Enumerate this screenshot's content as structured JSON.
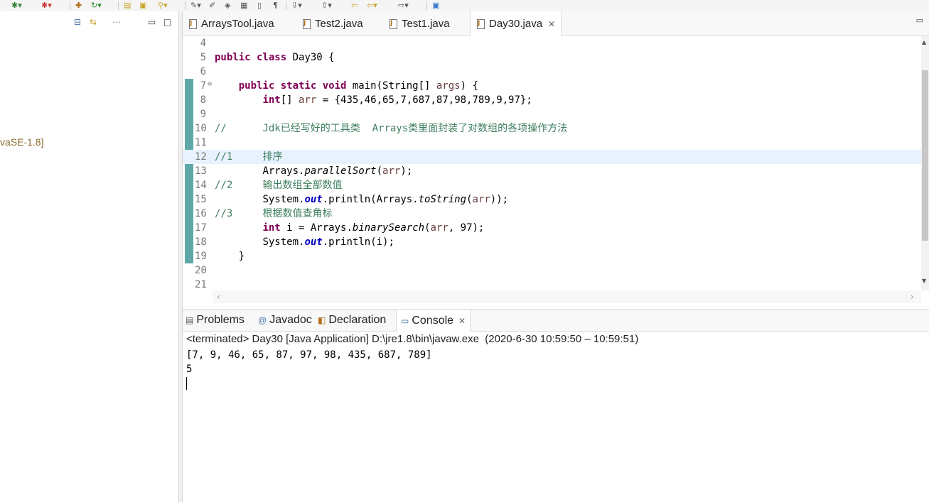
{
  "toolbar": {
    "icons": [
      "run-debug-icon",
      "run-icon",
      "new-icon",
      "open-icon",
      "search-icon",
      "nav-back-icon",
      "nav-forward-icon"
    ]
  },
  "left_pane": {
    "tree_item": "vaSE-1.8]"
  },
  "editor": {
    "tabs": [
      {
        "label": "ArraysTool.java"
      },
      {
        "label": "Test2.java"
      },
      {
        "label": "Test1.java"
      },
      {
        "label": "Day30.java",
        "active": true
      }
    ],
    "lines": [
      {
        "n": "4"
      },
      {
        "n": "5"
      },
      {
        "n": "6"
      },
      {
        "n": "7"
      },
      {
        "n": "8"
      },
      {
        "n": "9"
      },
      {
        "n": "10"
      },
      {
        "n": "11"
      },
      {
        "n": "12"
      },
      {
        "n": "13"
      },
      {
        "n": "14"
      },
      {
        "n": "15"
      },
      {
        "n": "16"
      },
      {
        "n": "17"
      },
      {
        "n": "18"
      },
      {
        "n": "19"
      },
      {
        "n": "20"
      },
      {
        "n": "21"
      }
    ],
    "code": {
      "l5_kw": "public class",
      "l5_rest": " Day30 {",
      "l7_kw": "public static void",
      "l7_rest": " main(String[] ",
      "l7_var": "args",
      "l7_end": ") {",
      "l8_kw": "int",
      "l8_rest": "[] ",
      "l8_var": "arr",
      "l8_end": " = {435,46,65,7,687,87,98,789,9,97};",
      "l10_cm1": "//",
      "l10_cm2": "Jdk已经写好的工具类  Arrays类里面封装了对数组的各项操作方法",
      "l12_cm1": "//1",
      "l12_cm2": "排序",
      "l13_a": "Arrays.",
      "l13_m": "parallelSort",
      "l13_b": "(",
      "l13_var": "arr",
      "l13_c": ");",
      "l14_cm1": "//2",
      "l14_cm2": "输出数组全部数值",
      "l15_a": "System.",
      "l15_f": "out",
      "l15_b": ".println(Arrays.",
      "l15_m": "toString",
      "l15_c": "(",
      "l15_var": "arr",
      "l15_d": "));",
      "l16_cm1": "//3",
      "l16_cm2": "根据数值查角标",
      "l17_kw": "int",
      "l17_b": " i = Arrays.",
      "l17_m": "binarySearch",
      "l17_c": "(",
      "l17_var": "arr",
      "l17_d": ", 97);",
      "l18_a": "System.",
      "l18_f": "out",
      "l18_b": ".println(i);",
      "l19": "}"
    }
  },
  "console": {
    "tabs": [
      {
        "label": "Problems"
      },
      {
        "label": "Javadoc"
      },
      {
        "label": "Declaration"
      },
      {
        "label": "Console",
        "active": true
      }
    ],
    "header": "<terminated> Day30 [Java Application] D:\\jre1.8\\bin\\javaw.exe  (2020-6-30 10:59:50 – 10:59:51)",
    "output": [
      "[7, 9, 46, 65, 87, 97, 98, 435, 687, 789]",
      "5"
    ]
  }
}
